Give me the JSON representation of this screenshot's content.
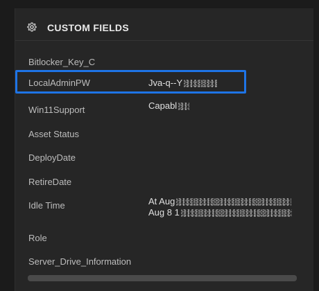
{
  "panel": {
    "title": "CUSTOM FIELDS",
    "icon": "gear-icon"
  },
  "fields": [
    {
      "label": "Bitlocker_Key_C",
      "value": ""
    },
    {
      "label": "LocalAdminPW",
      "value": "Jva-q--Y",
      "redacted": true
    },
    {
      "label": "Win11Support",
      "value": "Capabl",
      "redacted": true
    },
    {
      "label": "Asset Status",
      "value": ""
    },
    {
      "label": "DeployDate",
      "value": ""
    },
    {
      "label": "RetireDate",
      "value": ""
    },
    {
      "label": "Idle Time",
      "value_line1": "At Aug",
      "value_line2": "Aug 8 1",
      "redacted": true
    },
    {
      "label": "Role",
      "value": ""
    },
    {
      "label": "Server_Drive_Information",
      "value": ""
    }
  ],
  "colors": {
    "background": "#1b1b1b",
    "panel": "#262626",
    "highlight": "#1e74e6",
    "label": "#bdbdbd",
    "value": "#e0e0e0"
  }
}
